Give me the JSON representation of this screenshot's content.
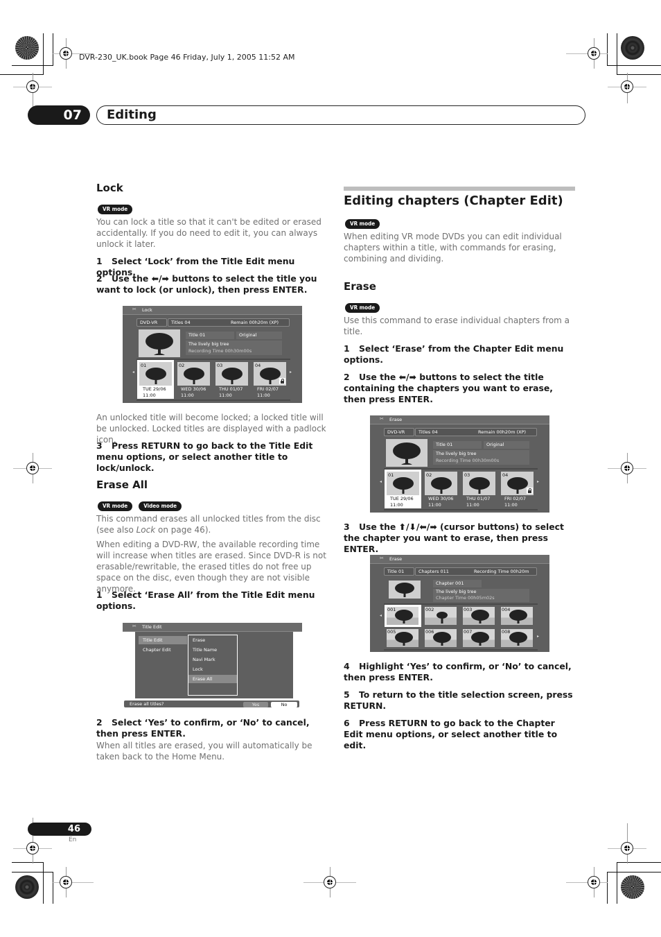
{
  "running_header": "DVR-230_UK.book  Page 46  Friday, July 1, 2005  11:52 AM",
  "chapter": {
    "number": "07",
    "title": "Editing"
  },
  "left": {
    "lock": {
      "heading": "Lock",
      "badges": [
        "VR mode"
      ],
      "intro": "You can lock a title so that it can't be edited or erased accidentally. If you do need to edit it, you can always unlock it later.",
      "steps": [
        {
          "n": "1",
          "text": "Select ‘Lock’ from the Title Edit menu options."
        },
        {
          "n": "2",
          "text": "Use the ⬅/➡ buttons to select the title you want to lock (or unlock), then press ENTER."
        }
      ],
      "after_screen": "An unlocked title will become locked; a locked title will be unlocked. Locked titles are displayed with a padlock icon.",
      "step3": {
        "n": "3",
        "text": "Press RETURN to go back to the Title Edit menu options, or select another title to lock/unlock."
      }
    },
    "erase_all": {
      "heading": "Erase All",
      "badges": [
        "VR mode",
        "Video mode"
      ],
      "para1a": "This command erases all unlocked titles from the disc (see also ",
      "para1_italic": "Lock",
      "para1b": " on page 46).",
      "para2": "When editing a DVD-RW, the available recording time will increase when titles are erased. Since DVD-R is not erasable/rewritable, the erased titles do not free up space on the disc, even though they are not visible anymore.",
      "step1": {
        "n": "1",
        "text": "Select ‘Erase All’ from the Title Edit menu options."
      },
      "step2": {
        "n": "2",
        "text": "Select ‘Yes’ to confirm, or ‘No’ to cancel, then press ENTER."
      },
      "after": "When all titles are erased, you will automatically be taken back to the Home Menu."
    }
  },
  "right": {
    "heading": "Editing chapters (Chapter Edit)",
    "badges": [
      "VR mode"
    ],
    "intro": "When editing VR mode DVDs you can edit individual chapters within a title, with commands for erasing, combining and dividing.",
    "erase": {
      "heading": "Erase",
      "badges": [
        "VR mode"
      ],
      "intro": "Use this command to erase individual chapters from a title.",
      "steps": [
        {
          "n": "1",
          "text": "Select ‘Erase’ from the Chapter Edit menu options."
        },
        {
          "n": "2",
          "text": "Use the ⬅/➡ buttons to select the title containing the chapters you want to erase, then press ENTER."
        }
      ],
      "step3": {
        "n": "3",
        "text": "Use the ⬆/⬇/⬅/➡ (cursor buttons) to select the chapter you want to erase, then press ENTER."
      },
      "steps_after": [
        {
          "n": "4",
          "text": "Highlight ‘Yes’ to confirm, or ‘No’ to cancel, then press ENTER."
        },
        {
          "n": "5",
          "text": "To return to the title selection screen, press RETURN."
        },
        {
          "n": "6",
          "text": "Press RETURN to go back to the Chapter Edit menu options, or select another title to edit."
        }
      ]
    }
  },
  "screens": {
    "lock": {
      "title": "Lock",
      "disc": "DVD-VR",
      "titles": "Titles 04",
      "remain": "Remain  00h20m (XP)",
      "title_name": "Title 01",
      "original": "Original",
      "desc": "The lively big tree",
      "rec_time": "Recording Time  00h30m00s",
      "thumbs": [
        {
          "num": "01",
          "day": "TUE 29/06",
          "time": "11:00",
          "selected": true,
          "locked": false
        },
        {
          "num": "02",
          "day": "WED 30/06",
          "time": "11:00",
          "selected": false,
          "locked": false
        },
        {
          "num": "03",
          "day": "THU 01/07",
          "time": "11:00",
          "selected": false,
          "locked": false
        },
        {
          "num": "04",
          "day": "FRI 02/07",
          "time": "11:00",
          "selected": false,
          "locked": true
        }
      ]
    },
    "title_edit": {
      "title": "Title Edit",
      "left_menu": [
        "Title Edit",
        "Chapter Edit"
      ],
      "sub_menu": [
        "Erase",
        "Title Name",
        "Navi Mark",
        "Lock",
        "Erase All"
      ],
      "highlighted": "Erase All",
      "prompt": "Erase all titles?",
      "yes": "Yes",
      "no": "No"
    },
    "erase_titles": {
      "title": "Erase",
      "disc": "DVD-VR",
      "titles": "Titles 04",
      "remain": "Remain  00h20m (XP)",
      "title_name": "Title 01",
      "original": "Original",
      "desc": "The lively big tree",
      "rec_time": "Recording Time  00h30m00s",
      "thumbs": [
        {
          "num": "01",
          "day": "TUE 29/06",
          "time": "11:00",
          "selected": true,
          "locked": false
        },
        {
          "num": "02",
          "day": "WED 30/06",
          "time": "11:00",
          "selected": false,
          "locked": false
        },
        {
          "num": "03",
          "day": "THU 01/07",
          "time": "11:00",
          "selected": false,
          "locked": false
        },
        {
          "num": "04",
          "day": "FRI 02/07",
          "time": "11:00",
          "selected": false,
          "locked": true
        }
      ]
    },
    "erase_chapters": {
      "title": "Erase",
      "title_box": "Title 01",
      "chapters": "Chapters 011",
      "rec_time": "Recording Time  00h20m",
      "chapter_name": "Chapter 001",
      "desc": "The lively big tree",
      "chapter_time": "Chapter Time  00h05m02s",
      "thumbs": [
        "001",
        "002",
        "003",
        "004",
        "005",
        "006",
        "007",
        "008"
      ]
    }
  },
  "footer": {
    "page": "46",
    "lang": "En"
  }
}
